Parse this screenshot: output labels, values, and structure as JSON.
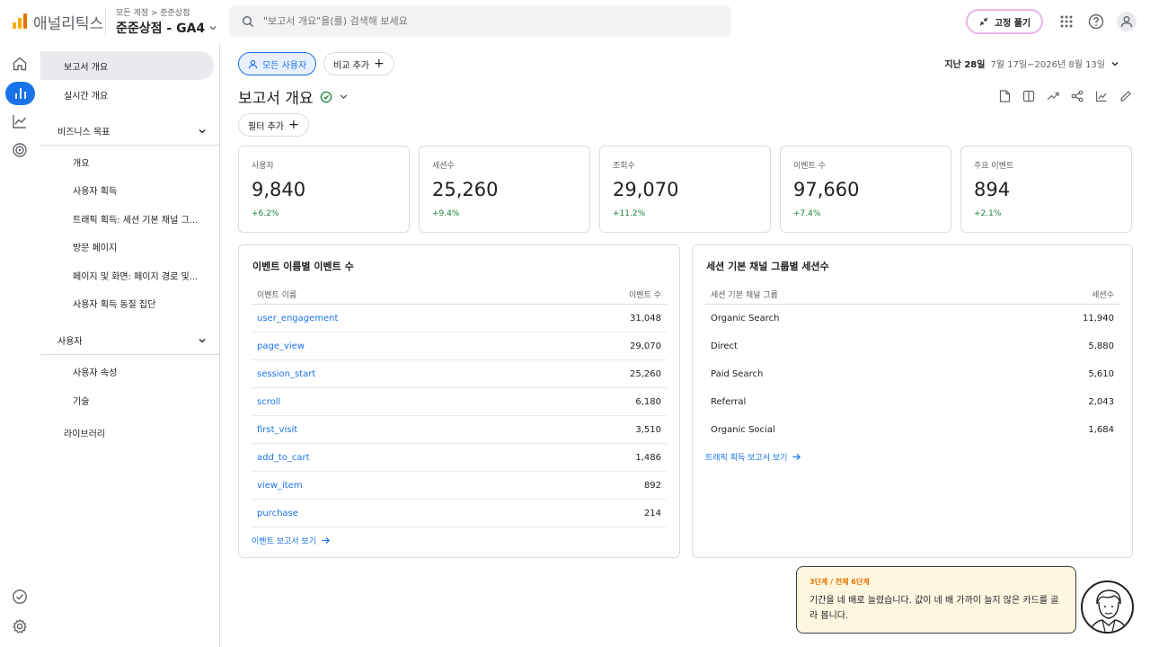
{
  "header": {
    "app_name": "애널리틱스",
    "breadcrumb": "모든 계정 > 준준상점",
    "property": "준준상점 - GA4",
    "search_placeholder": "\"보고서 개요\"을(를) 검색해 보세요",
    "pin_button": "고정 풀기"
  },
  "nav": {
    "top_items": [
      "보고서 개요",
      "실시간 개요"
    ],
    "section_business": "비즈니스 목표",
    "business_items": [
      "개요",
      "사용자 획득",
      "트래픽 획득: 세션 기본 채널 그...",
      "방문 페이지",
      "페이지 및 화면: 페이지 경로 및...",
      "사용자 획득 동질 집단"
    ],
    "section_user": "사용자",
    "user_items": [
      "사용자 속성",
      "기술"
    ],
    "library": "라이브러리"
  },
  "toolbar": {
    "segment_chip": "모든 사용자",
    "compare_chip": "비교 추가",
    "date_prefix": "지난 28일",
    "date_range": "7월 17일~2026년 8월 13일",
    "page_title": "보고서 개요",
    "filter_chip": "필터 추가"
  },
  "metrics": [
    {
      "label": "사용자",
      "value": "9,840",
      "change": "+6.2%"
    },
    {
      "label": "세션수",
      "value": "25,260",
      "change": "+9.4%"
    },
    {
      "label": "조회수",
      "value": "29,070",
      "change": "+11.2%"
    },
    {
      "label": "이벤트 수",
      "value": "97,660",
      "change": "+7.4%"
    },
    {
      "label": "주요 이벤트",
      "value": "894",
      "change": "+2.1%"
    }
  ],
  "events_panel": {
    "title": "이벤트 이름별 이벤트 수",
    "col_name": "이벤트 이름",
    "col_value": "이벤트 수",
    "rows": [
      {
        "name": "user_engagement",
        "value": "31,048"
      },
      {
        "name": "page_view",
        "value": "29,070"
      },
      {
        "name": "session_start",
        "value": "25,260"
      },
      {
        "name": "scroll",
        "value": "6,180"
      },
      {
        "name": "first_visit",
        "value": "3,510"
      },
      {
        "name": "add_to_cart",
        "value": "1,486"
      },
      {
        "name": "view_item",
        "value": "892"
      },
      {
        "name": "purchase",
        "value": "214"
      }
    ],
    "link": "이벤트 보고서 보기"
  },
  "channels_panel": {
    "title": "세션 기본 채널 그룹별 세션수",
    "col_name": "세션 기본 채널 그룹",
    "col_value": "세션수",
    "rows": [
      {
        "name": "Organic Search",
        "value": "11,940"
      },
      {
        "name": "Direct",
        "value": "5,880"
      },
      {
        "name": "Paid Search",
        "value": "5,610"
      },
      {
        "name": "Referral",
        "value": "2,043"
      },
      {
        "name": "Organic Social",
        "value": "1,684"
      }
    ],
    "link": "트래픽 획득 보고서 보기"
  },
  "tooltip": {
    "step": "3단계 / 전체 6단계",
    "message": "기간을 네 배로 늘렸습니다. 값이 네 배 가까이 늘지 않은 카드를 골라 봅니다."
  },
  "colors": {
    "accent": "#1a73e8",
    "positive": "#188038",
    "logo_orange": "#f9ab00",
    "logo_dark": "#e37400"
  }
}
